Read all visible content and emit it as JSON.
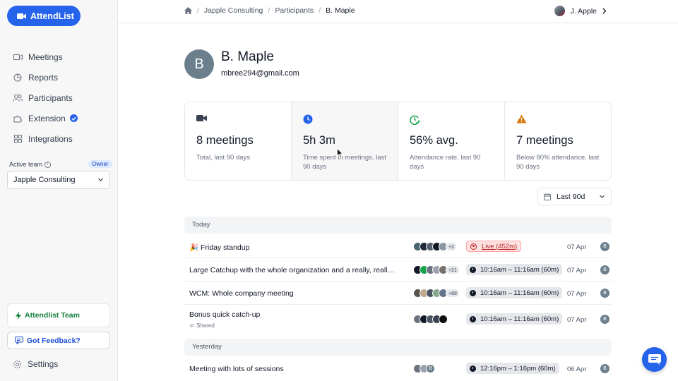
{
  "app": {
    "name": "AttendList",
    "brand_color": "#2563eb"
  },
  "sidebar": {
    "items": [
      {
        "label": "Meetings",
        "icon": "video-icon"
      },
      {
        "label": "Reports",
        "icon": "chart-pie-icon"
      },
      {
        "label": "Participants",
        "icon": "users-icon"
      },
      {
        "label": "Extension",
        "icon": "puzzle-icon",
        "verified": true
      },
      {
        "label": "Integrations",
        "icon": "grid-icon"
      }
    ],
    "active_team_label": "Active team",
    "owner_badge": "Owner",
    "team_value": "Japple Consulting",
    "team_card": "Attendlist Team",
    "feedback": "Got Feedback?",
    "settings": "Settings"
  },
  "header": {
    "breadcrumb": [
      "Japple Consulting",
      "Participants",
      "B. Maple"
    ],
    "user": "J. Apple"
  },
  "profile": {
    "initial": "B",
    "name": "B. Maple",
    "email": "mbree294@gmail.com"
  },
  "stats": [
    {
      "value": "8 meetings",
      "label": "Total, last 90 days",
      "icon": "camera-icon",
      "color": "#374151"
    },
    {
      "value": "5h 3m",
      "label": "Time spent in meetings, last 90 days",
      "icon": "clock-icon",
      "color": "#2563eb"
    },
    {
      "value": "56% avg.",
      "label": "Attendance rate, last 90 days",
      "icon": "clock-check-icon",
      "color": "#16a34a"
    },
    {
      "value": "7 meetings",
      "label": "Below 80% attendance, last 90 days",
      "icon": "warning-icon",
      "color": "#d97706"
    }
  ],
  "range": {
    "value": "Last 90d"
  },
  "groups": [
    {
      "label": "Today",
      "meetings": [
        {
          "title": "🎉 Friday standup",
          "more": "+2",
          "time": "Live (452m)",
          "live": true,
          "date": "07 Apr",
          "owner": "B"
        },
        {
          "title": "Large Catchup with the whole organization and a really, really long name",
          "more": "+21",
          "time": "10:16am – 11:16am (60m)",
          "live": false,
          "date": "07 Apr",
          "owner": "B"
        },
        {
          "title": "WCM: Whole company meeting",
          "more": "+68",
          "time": "10:16am – 11:16am (60m)",
          "live": false,
          "date": "07 Apr",
          "owner": "B"
        },
        {
          "title": "Bonus quick catch-up",
          "shared": "Shared",
          "more": "",
          "time": "10:16am – 11:16am (60m)",
          "live": false,
          "date": "07 Apr",
          "owner": "B"
        }
      ]
    },
    {
      "label": "Yesterday",
      "meetings": [
        {
          "title": "Meeting with lots of sessions",
          "more": "",
          "extra_avatar": "B",
          "time": "12:16pm – 1:16pm (60m)",
          "live": false,
          "date": "06 Apr",
          "owner": "B"
        }
      ]
    }
  ]
}
